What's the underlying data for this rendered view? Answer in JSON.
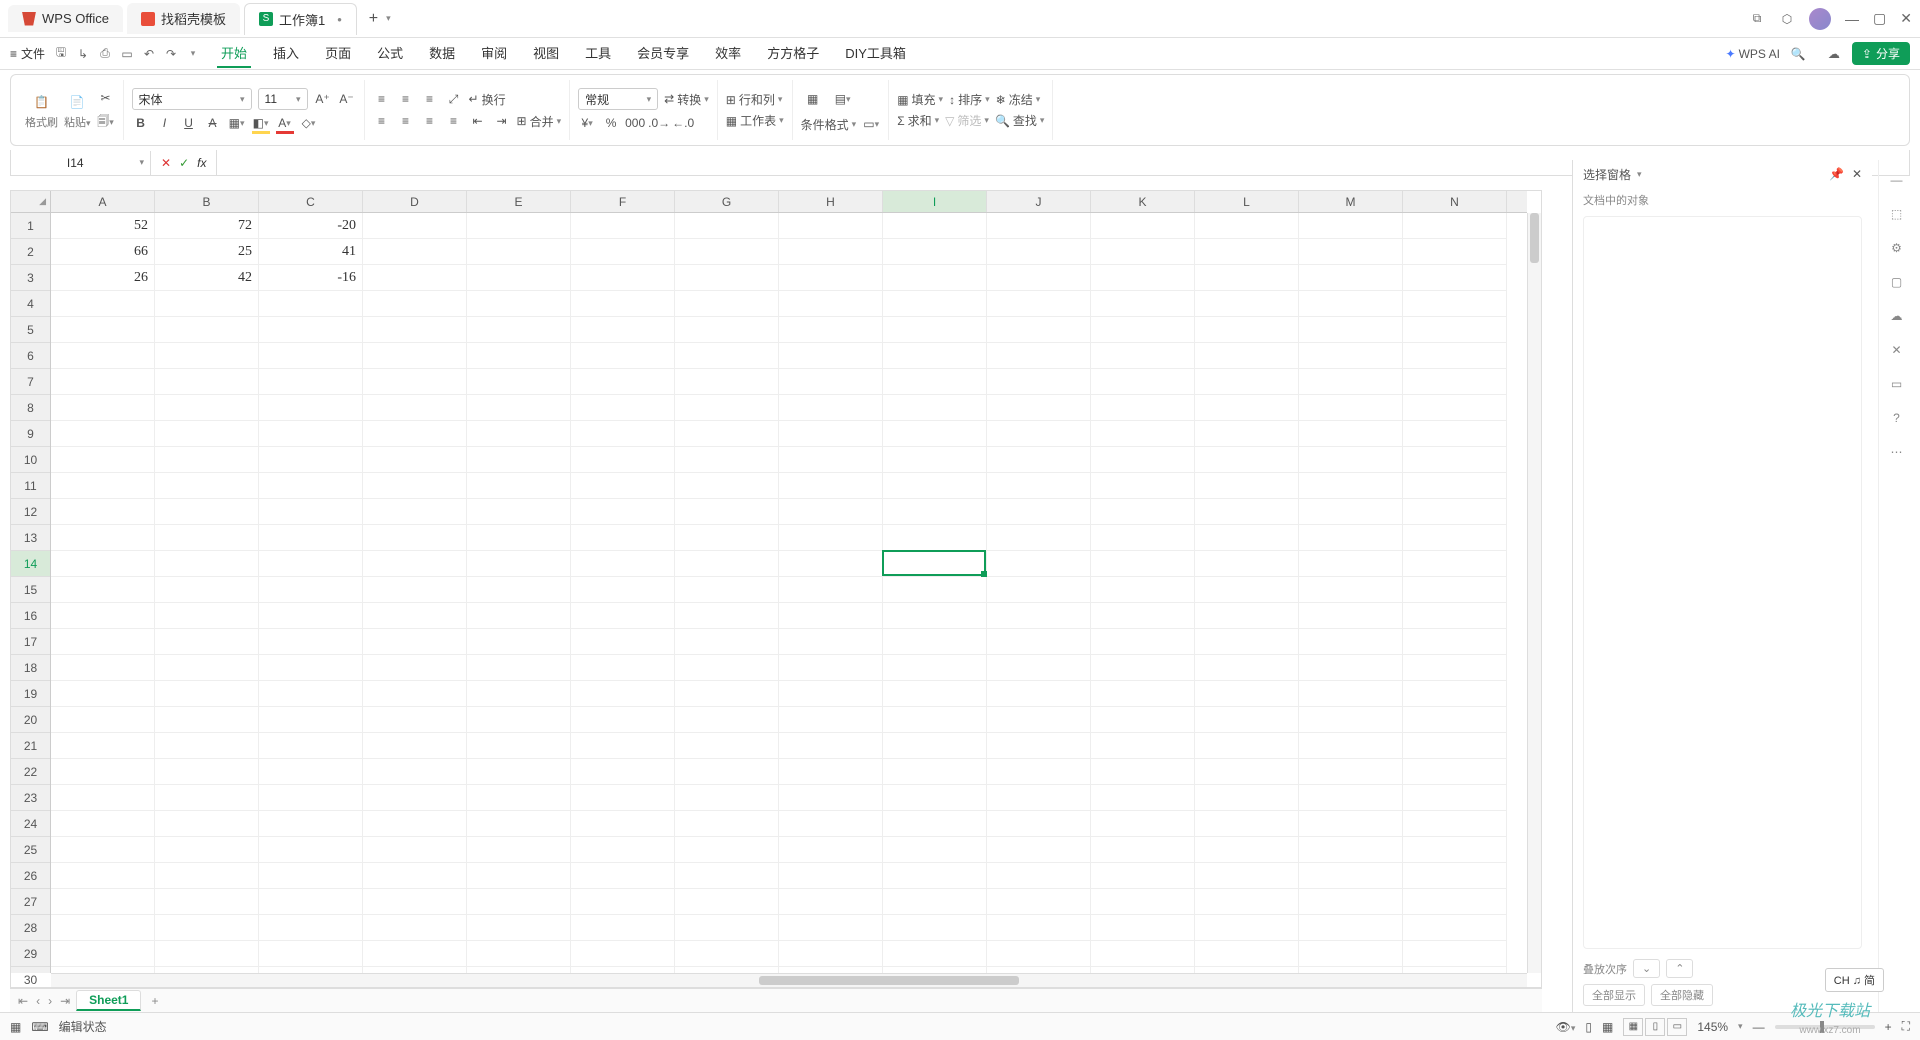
{
  "titlebar": {
    "tabs": [
      {
        "icon": "wps",
        "label": "WPS Office"
      },
      {
        "icon": "dk",
        "label": "找稻壳模板"
      },
      {
        "icon": "xls",
        "label": "工作簿1",
        "active": true,
        "dirty": "•"
      }
    ],
    "add": "+"
  },
  "menubar": {
    "file": "文件",
    "tabs": [
      "开始",
      "插入",
      "页面",
      "公式",
      "数据",
      "审阅",
      "视图",
      "工具",
      "会员专享",
      "效率",
      "方方格子",
      "DIY工具箱"
    ],
    "wps_ai": "WPS AI",
    "share": "分享"
  },
  "ribbon": {
    "format_painter": "格式刷",
    "paste": "粘贴",
    "font_name": "宋体",
    "font_size": "11",
    "number_format": "常规",
    "convert": "转换",
    "rows_cols": "行和列",
    "worksheet": "工作表",
    "cond_fmt": "条件格式",
    "fill": "填充",
    "sort": "排序",
    "freeze": "冻结",
    "sum": "求和",
    "filter": "筛选",
    "find": "查找",
    "wrap": "换行",
    "merge": "合并"
  },
  "formula": {
    "namebox": "I14",
    "fx": "fx"
  },
  "grid": {
    "cols": [
      "A",
      "B",
      "C",
      "D",
      "E",
      "F",
      "G",
      "H",
      "I",
      "J",
      "K",
      "L",
      "M",
      "N"
    ],
    "rows": 30,
    "active_row": 14,
    "active_col": "I",
    "data": [
      {
        "r": 1,
        "A": "52",
        "B": "72",
        "C": "-20"
      },
      {
        "r": 2,
        "A": "66",
        "B": "25",
        "C": "41"
      },
      {
        "r": 3,
        "A": "26",
        "B": "42",
        "C": "-16"
      }
    ]
  },
  "rpanel": {
    "title": "选择窗格",
    "sub": "文档中的对象",
    "stack": "叠放次序",
    "show_all": "全部显示",
    "hide_all": "全部隐藏"
  },
  "sheetbar": {
    "sheet": "Sheet1"
  },
  "status": {
    "mode": "编辑状态",
    "zoom": "145%"
  },
  "ime": "CH ♫ 简",
  "footer": {
    "big": "极光下载站",
    "small": "www.xz7.com"
  }
}
